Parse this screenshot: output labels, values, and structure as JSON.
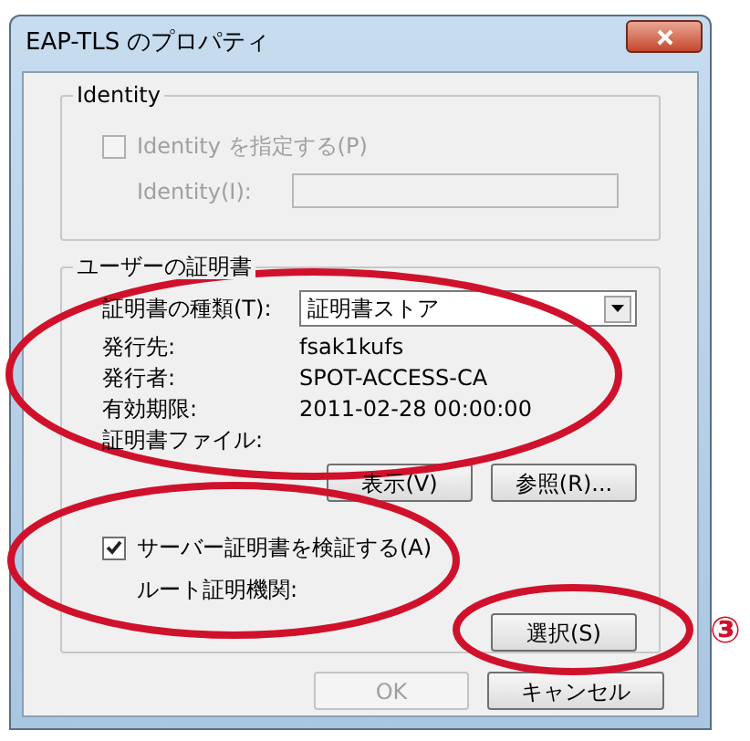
{
  "window": {
    "title": "EAP-TLS のプロパティ"
  },
  "identity_group": {
    "title": "Identity",
    "checkbox": {
      "label": "Identity を指定する(P)",
      "checked": false,
      "disabled": true
    },
    "field": {
      "label": "Identity(I):",
      "disabled": true
    }
  },
  "certificate_group": {
    "title": "ユーザーの証明書",
    "type_field": {
      "label": "証明書の種類(T):",
      "value": "証明書ストア"
    },
    "details": [
      {
        "label": "発行先:",
        "value": "fsak1kufs"
      },
      {
        "label": "発行者:",
        "value": "SPOT-ACCESS-CA"
      },
      {
        "label": "有効期限:",
        "value": "2011-02-28 00:00:00"
      },
      {
        "label": "証明書ファイル:"
      }
    ],
    "buttons": [
      {
        "label": "表示(V)"
      },
      {
        "label": "参照(R)..."
      }
    ],
    "verify_checkbox": {
      "label": "サーバー証明書を検証する(A)",
      "checked": true
    },
    "root_label": "ルート証明機関:",
    "select_button": {
      "label": "選択(S)"
    }
  },
  "footer_buttons": [
    {
      "label": "OK",
      "disabled": true
    },
    {
      "label": "キャンセル",
      "disabled": false
    }
  ],
  "annotation": {
    "label": "③"
  }
}
